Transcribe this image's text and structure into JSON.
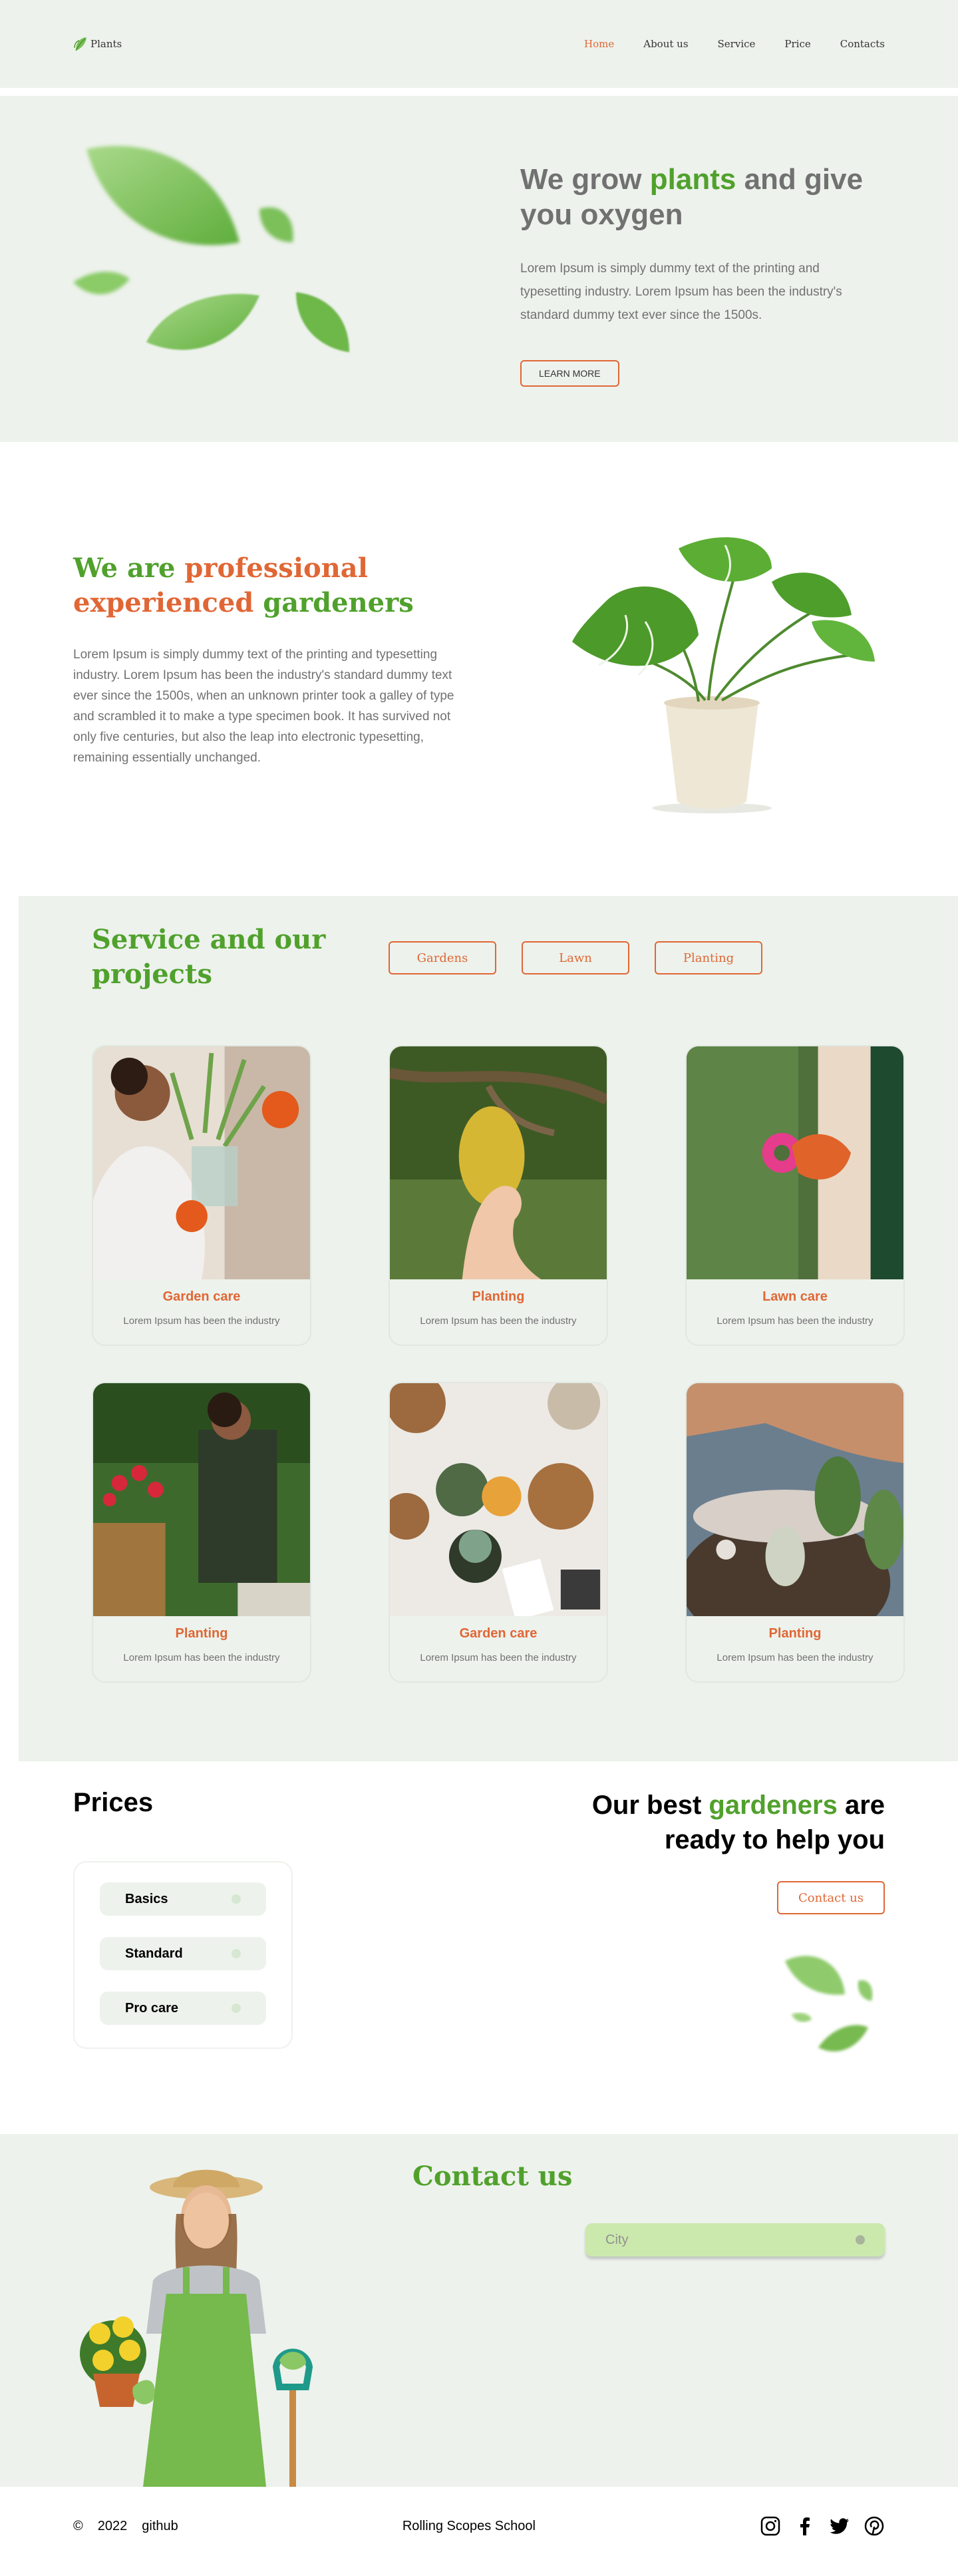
{
  "header": {
    "logo_text": "Plants",
    "nav": [
      "Home",
      "About us",
      "Service",
      "Price",
      "Contacts"
    ]
  },
  "hero": {
    "title_part1": "We grow ",
    "title_highlight": "plants",
    "title_part2": " and give you oxygen",
    "description": "Lorem Ipsum is simply dummy text of the printing and typesetting industry. Lorem Ipsum has been the industry's standard dummy text ever since the 1500s.",
    "button": "LEARN MORE"
  },
  "about": {
    "title_part1": "We are ",
    "title_highlight1": "professional experienced",
    "title_part2": " gardeners",
    "description": "Lorem Ipsum is simply dummy text of the printing and typesetting industry. Lorem Ipsum has been the industry's standard dummy text ever since the 1500s, when an unknown printer took a galley of type and scrambled it to make a type specimen book. It has survived not only five centuries, but also the leap into electronic typesetting, remaining essentially unchanged."
  },
  "service": {
    "title": "Service and our projects",
    "filters": [
      "Gardens",
      "Lawn",
      "Planting"
    ],
    "cards": [
      {
        "title": "Garden care",
        "desc": "Lorem Ipsum has been the industry"
      },
      {
        "title": "Planting",
        "desc": "Lorem Ipsum has been the industry"
      },
      {
        "title": "Lawn care",
        "desc": "Lorem Ipsum has been the industry"
      },
      {
        "title": "Planting",
        "desc": "Lorem Ipsum has been the industry"
      },
      {
        "title": "Garden care",
        "desc": "Lorem Ipsum has been the industry"
      },
      {
        "title": "Planting",
        "desc": "Lorem Ipsum has been the industry"
      }
    ]
  },
  "prices": {
    "title": "Prices",
    "items": [
      "Basics",
      "Standard",
      "Pro care"
    ]
  },
  "best": {
    "title_part1": "Our best ",
    "title_highlight": "gardeners",
    "title_part2": " are ready to help you",
    "button": "Contact us"
  },
  "contact": {
    "title": "Contact us",
    "city_placeholder": "City"
  },
  "footer": {
    "copyright_symbol": "©",
    "year": "2022",
    "github": "github",
    "school": "Rolling Scopes School",
    "socials": [
      "instagram-icon",
      "facebook-icon",
      "twitter-icon",
      "pinterest-icon"
    ]
  },
  "colors": {
    "accent_green": "#50A12C",
    "accent_orange": "#E06735",
    "background_light": "#EDF2EC",
    "text_gray": "#717171"
  }
}
